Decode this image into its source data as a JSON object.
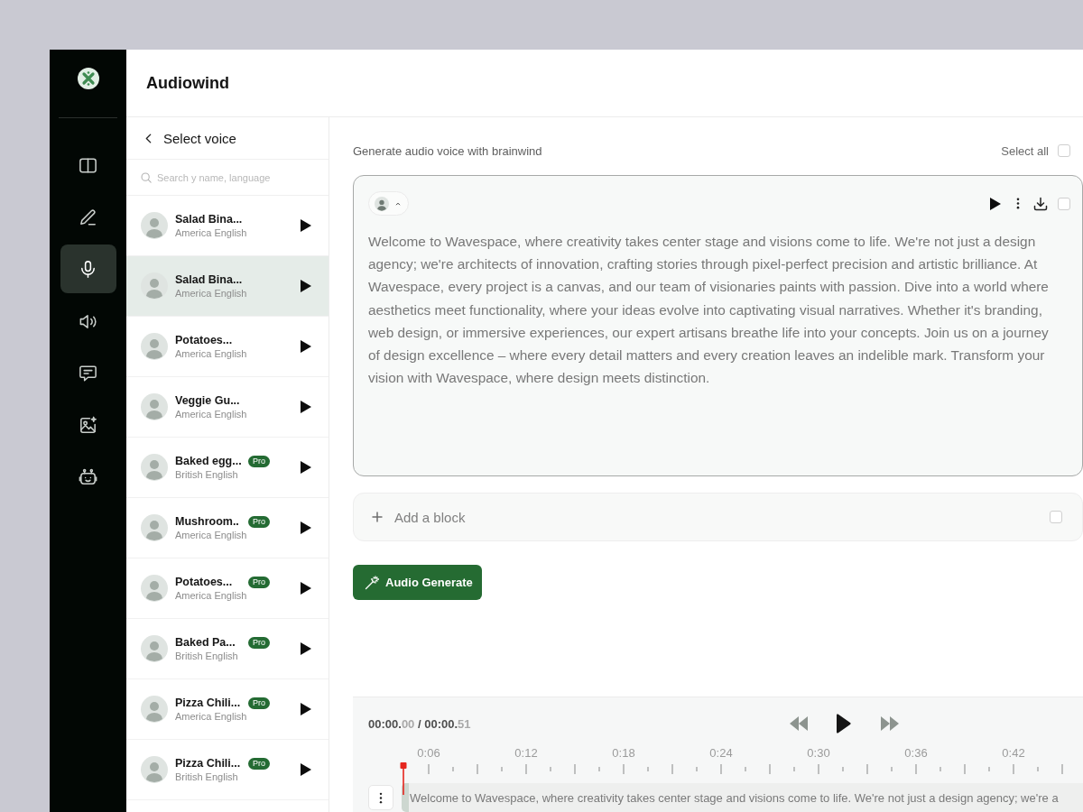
{
  "app": {
    "title": "Audiowind"
  },
  "sidebar": {
    "items": [
      {
        "kind": "book",
        "selected": false
      },
      {
        "kind": "pen",
        "selected": false
      },
      {
        "kind": "microphone",
        "selected": true
      },
      {
        "kind": "speaker",
        "selected": false
      },
      {
        "kind": "chat",
        "selected": false
      },
      {
        "kind": "image",
        "selected": false
      },
      {
        "kind": "robot",
        "selected": false
      }
    ]
  },
  "voice_panel": {
    "title": "Select voice",
    "search": {
      "placeholder": "Search y name, language"
    },
    "voices": [
      {
        "name": "Salad Bina...",
        "language": "America English",
        "selected": false
      },
      {
        "name": "Salad Bina...",
        "language": "America English",
        "selected": true
      },
      {
        "name": "Potatoes...",
        "language": "America English",
        "selected": false
      },
      {
        "name": "Veggie Gu...",
        "language": "America English",
        "selected": false
      },
      {
        "name": "Baked egg...",
        "language": "British English",
        "badge": "Pro",
        "selected": false
      },
      {
        "name": "Mushroom..",
        "language": "America English",
        "badge": "Pro",
        "selected": false
      },
      {
        "name": "Potatoes...",
        "language": "America English",
        "badge": "Pro",
        "selected": false
      },
      {
        "name": "Baked Pa...",
        "language": "British English",
        "badge": "Pro",
        "selected": false
      },
      {
        "name": "Pizza Chili...",
        "language": "America English",
        "badge": "Pro",
        "selected": false
      },
      {
        "name": "Pizza Chili...",
        "language": "British English",
        "badge": "Pro",
        "selected": false
      }
    ]
  },
  "editor": {
    "heading": "Generate audio voice with brainwind",
    "select_all": {
      "label": "Select all",
      "checked": false
    },
    "blocks": [
      {
        "text": "Welcome to Wavespace, where creativity takes center stage and visions come to life. We're not just a design agency; we're architects of innovation, crafting stories through pixel-perfect precision and artistic brilliance. At Wavespace, every project is a canvas, and our team of visionaries paints with passion. Dive into a world where aesthetics meet functionality, where your ideas evolve into captivating visual narratives. Whether it's branding, web design, or immersive experiences, our expert artisans breathe life into your concepts. Join us on a journey of design excellence – where every detail matters and every creation leaves an indelible mark. Transform your vision with Wavespace, where design meets distinction.",
        "checked": false
      }
    ],
    "add_block": {
      "label": "Add a block",
      "checked": false
    },
    "generate_button": "Audio Generate"
  },
  "player": {
    "elapsed": "00:00.00",
    "separator": "/",
    "total": "00:00.51",
    "ticks": [
      "0:06",
      "0:12",
      "0:18",
      "0:24",
      "0:30",
      "0:36",
      "0:42"
    ],
    "clip_text": "Welcome to Wavespace, where creativity takes center stage and visions come to life. We're not just a design agency; we're a"
  }
}
